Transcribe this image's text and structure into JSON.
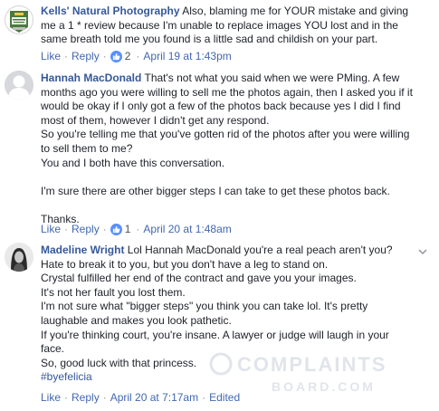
{
  "comments": [
    {
      "author": "Kells' Natural Photography",
      "badge_text": "2017 Readers' Choice SILVER",
      "first_line": "Also, blaming me for YOUR mistake and giving",
      "lines": [
        "me a 1 * review because I'm unable to replace images YOU lost and in the",
        "same breath told me you found is a little sad and childish on your part."
      ],
      "actions": {
        "like": "Like",
        "reply": "Reply",
        "reaction_count": "2",
        "time": "April 19 at 1:43pm"
      }
    },
    {
      "author": "Hannah MacDonald",
      "first_line": "That's not what you said when we were PMing. A few",
      "lines": [
        "months ago you were willing to sell me the photos again, then I asked you if it",
        "would be okay if I only got a few of the photos back because yes I did I find",
        "most of them, however I didn't get any respond.",
        "So you're telling me that you've gotten rid of the photos after you were willing",
        "to sell them to me?",
        "You and I both have this conversation.",
        "",
        "I'm sure there are other bigger steps I can take to get these photos back.",
        "",
        "Thanks."
      ],
      "actions": {
        "like": "Like",
        "reply": "Reply",
        "reaction_count": "1",
        "time": "April 20 at 1:48am"
      }
    },
    {
      "author": "Madeline Wright",
      "first_line": "Lol Hannah MacDonald you're a real peach aren't you?",
      "lines": [
        "Hate to break it to you, but you don't have a leg to stand on.",
        "Crystal fulfilled her end of the contract and gave you your images.",
        "It's not her fault you lost them.",
        "I'm not sure what \"bigger steps\" you think you can take lol. It's pretty",
        "laughable and makes you look pathetic.",
        "If you're thinking court, you're insane. A lawyer or judge will laugh in your",
        "face.",
        "So, good luck with that princess."
      ],
      "hashtag": "#byefelicia",
      "actions": {
        "like": "Like",
        "reply": "Reply",
        "time": "April 20 at 7:17am",
        "edited": "Edited"
      }
    }
  ],
  "watermark": {
    "line1": "COMPLAINTS",
    "line2": "BOARD.COM"
  },
  "colors": {
    "link": "#365899",
    "action": "#4267b2",
    "muted": "#90949c",
    "like": "#5890ff"
  },
  "icons": {
    "like": "thumbs-up-icon",
    "options": "chevron-down-icon"
  }
}
